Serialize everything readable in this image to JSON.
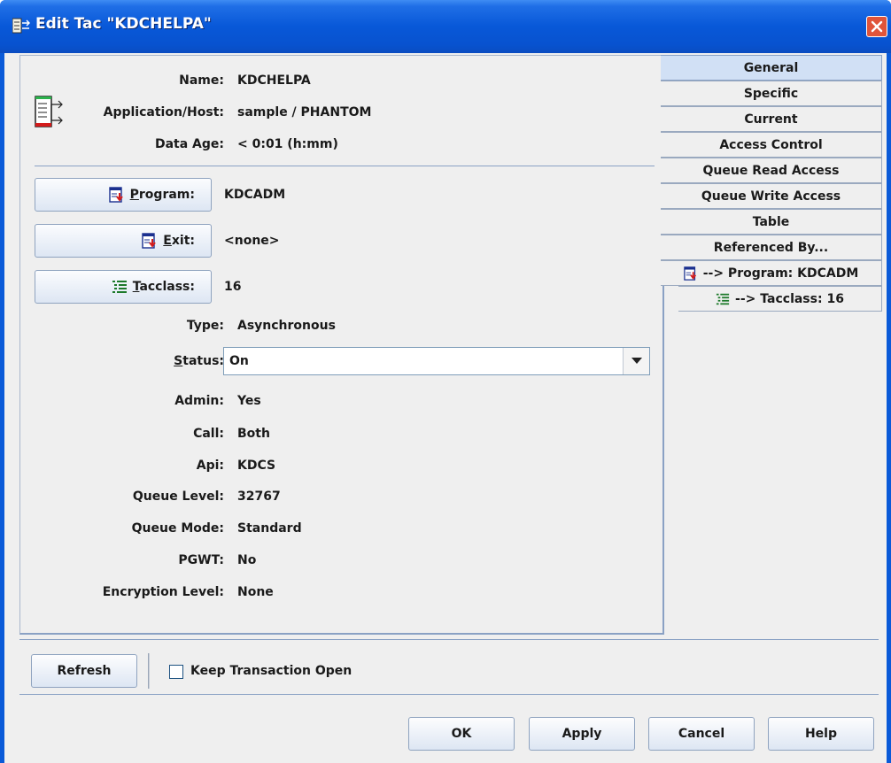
{
  "window": {
    "title": "Edit Tac \"KDCHELPA\"",
    "icon": "tac-icon",
    "close": "close-icon"
  },
  "header": {
    "name_label": "Name:",
    "name_value": "KDCHELPA",
    "apphost_label": "Application/Host:",
    "apphost_value": "sample / PHANTOM",
    "dataage_label": "Data Age:",
    "dataage_value": "< 0:01 (h:mm)"
  },
  "links": {
    "program": {
      "label_u": "P",
      "label_rest": "rogram:",
      "value": "KDCADM"
    },
    "exit": {
      "label_u": "E",
      "label_rest": "xit:",
      "value": "<none>"
    },
    "tacclass": {
      "label_u": "T",
      "label_rest": "acclass:",
      "value": "16"
    }
  },
  "fields": {
    "type_label": "Type:",
    "type_value": "Asynchronous",
    "status_label_u": "S",
    "status_label_rest": "tatus:",
    "status_value": "On",
    "admin_label": "Admin:",
    "admin_value": "Yes",
    "call_label": "Call:",
    "call_value": "Both",
    "api_label": "Api:",
    "api_value": "KDCS",
    "queuelevel_label": "Queue Level:",
    "queuelevel_value": "32767",
    "queuemode_label": "Queue Mode:",
    "queuemode_value": "Standard",
    "pgwt_label": "PGWT:",
    "pgwt_value": "No",
    "encryption_label": "Encryption Level:",
    "encryption_value": "None"
  },
  "tabs": [
    {
      "label": "General"
    },
    {
      "label": "Specific"
    },
    {
      "label": "Current"
    },
    {
      "label": "Access Control"
    },
    {
      "label": "Queue Read Access"
    },
    {
      "label": "Queue Write Access"
    },
    {
      "label": "Table"
    },
    {
      "label": "Referenced By..."
    },
    {
      "label": "--> Program: KDCADM"
    },
    {
      "label": "--> Tacclass: 16"
    }
  ],
  "bottom": {
    "refresh": "Refresh",
    "keep_open": "Keep Transaction Open",
    "ok": "OK",
    "apply": "Apply",
    "cancel": "Cancel",
    "help": "Help"
  },
  "colors": {
    "titlebar": "#0858d8",
    "tab_active": "#d1e0f5",
    "panel_border": "#8aa1c4"
  }
}
